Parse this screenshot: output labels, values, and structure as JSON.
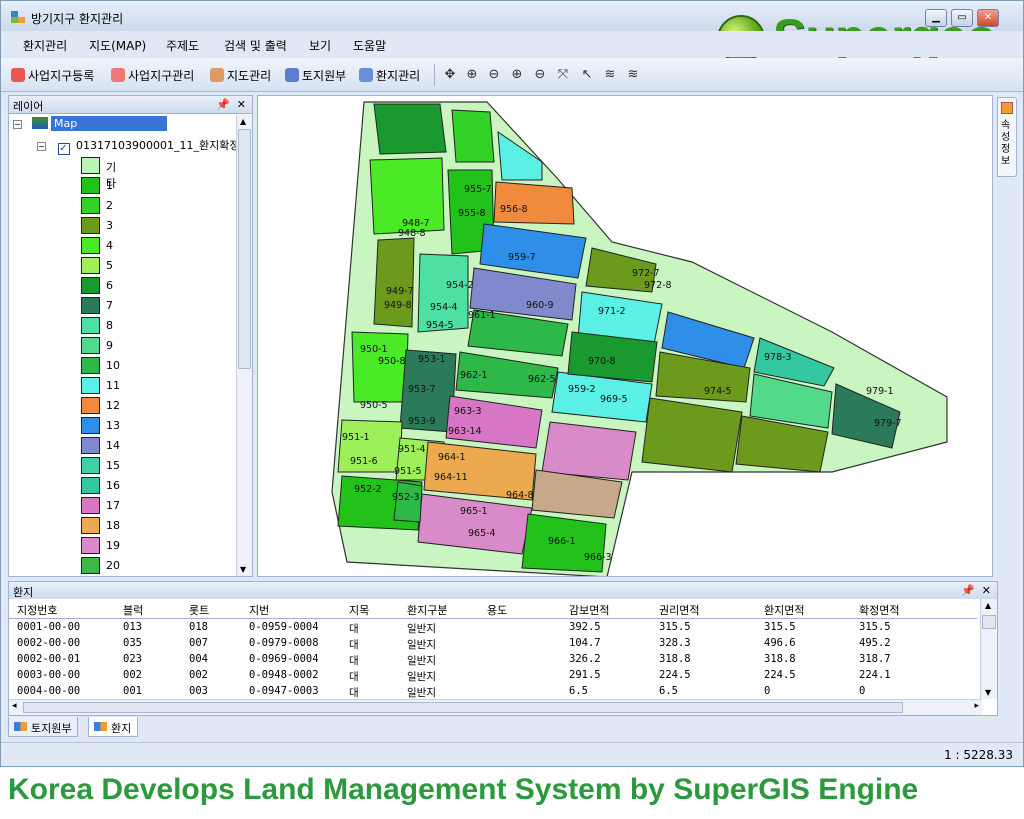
{
  "window": {
    "title": "방기지구 환지관리",
    "logo_text": "Supergeo"
  },
  "menu": [
    "환지관리",
    "지도(MAP)",
    "주제도",
    "검색 및 출력",
    "보기",
    "도움말"
  ],
  "toolbar": {
    "buttons": [
      "사업지구등록",
      "사업지구관리",
      "지도관리",
      "토지원부",
      "환지관리"
    ],
    "tools": [
      "pan-icon",
      "zoom-extent-icon",
      "zoom-previous-icon",
      "zoom-in-icon",
      "zoom-out-icon",
      "full-extent-icon",
      "select-icon",
      "layer-stack-icon",
      "layer-stack-2-icon"
    ]
  },
  "layer_panel": {
    "title": "레이어",
    "map_node": "Map",
    "layer_node": "01317103900001_11_환지확정",
    "legend": [
      {
        "label": "기타",
        "color": "#b9f5b4"
      },
      {
        "label": "1",
        "color": "#22c21a"
      },
      {
        "label": "2",
        "color": "#33d226"
      },
      {
        "label": "3",
        "color": "#6c9a1d"
      },
      {
        "label": "4",
        "color": "#4bea26"
      },
      {
        "label": "5",
        "color": "#9ef05b"
      },
      {
        "label": "6",
        "color": "#1a9a2e"
      },
      {
        "label": "7",
        "color": "#2b7a5a"
      },
      {
        "label": "8",
        "color": "#4ee0a3"
      },
      {
        "label": "9",
        "color": "#52d98a"
      },
      {
        "label": "10",
        "color": "#2fb84a"
      },
      {
        "label": "11",
        "color": "#5af0e6"
      },
      {
        "label": "12",
        "color": "#f08a3c"
      },
      {
        "label": "13",
        "color": "#2f8ee8"
      },
      {
        "label": "14",
        "color": "#8089cc"
      },
      {
        "label": "15",
        "color": "#3ed1a8"
      },
      {
        "label": "16",
        "color": "#34c8a0"
      },
      {
        "label": "17",
        "color": "#d776c4"
      },
      {
        "label": "18",
        "color": "#eca950"
      },
      {
        "label": "19",
        "color": "#d98ac8"
      },
      {
        "label": "20",
        "color": "#3cb84a"
      }
    ]
  },
  "side_tab": {
    "label": "속성정보"
  },
  "map": {
    "labels": [
      "955-7",
      "955-8",
      "956-8",
      "948-7",
      "948-8",
      "959-7",
      "972-7",
      "972-8",
      "954-2",
      "949-7",
      "949-8",
      "960-9",
      "971-2",
      "954-4",
      "961-1",
      "954-5",
      "950-1",
      "950-8",
      "953-1",
      "970-8",
      "978-3",
      "962-1",
      "962-5",
      "959-2",
      "969-5",
      "974-5",
      "979-1",
      "953-7",
      "950-5",
      "953-9",
      "963-3",
      "963-14",
      "979-7",
      "951-1",
      "951-4",
      "951-6",
      "951-5",
      "964-1",
      "964-11",
      "952-2",
      "952-3",
      "964-8",
      "965-1",
      "966-1",
      "965-4",
      "966-3"
    ]
  },
  "grid": {
    "title": "환지",
    "columns": [
      "지정번호",
      "블럭",
      "롯트",
      "지번",
      "지목",
      "환지구분",
      "용도",
      "감보면적",
      "권리면적",
      "환지면적",
      "확정면적"
    ],
    "rows": [
      [
        "0001-00-00",
        "013",
        "018",
        "0-0959-0004",
        "대",
        "일반지",
        "",
        "392.5",
        "315.5",
        "315.5",
        "315.5"
      ],
      [
        "0002-00-00",
        "035",
        "007",
        "0-0979-0008",
        "대",
        "일반지",
        "",
        "104.7",
        "328.3",
        "496.6",
        "495.2"
      ],
      [
        "0002-00-01",
        "023",
        "004",
        "0-0969-0004",
        "대",
        "일반지",
        "",
        "326.2",
        "318.8",
        "318.8",
        "318.7"
      ],
      [
        "0003-00-00",
        "002",
        "002",
        "0-0948-0002",
        "대",
        "일반지",
        "",
        "291.5",
        "224.5",
        "224.5",
        "224.1"
      ],
      [
        "0004-00-00",
        "001",
        "003",
        "0-0947-0003",
        "대",
        "일반지",
        "",
        "6.5",
        "6.5",
        "0",
        "0"
      ]
    ]
  },
  "bottom_tabs": [
    "토지원부",
    "환지"
  ],
  "status": {
    "scale": "1 : 5228.33"
  },
  "caption": "Korea Develops Land Management System by SuperGIS Engine"
}
